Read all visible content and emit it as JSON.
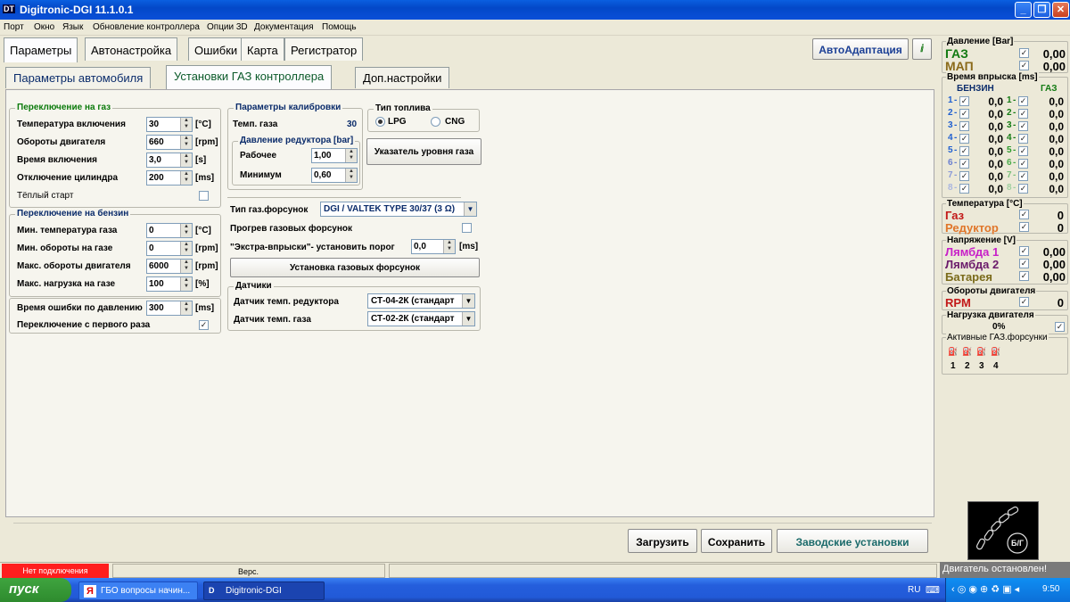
{
  "window": {
    "title": "Digitronic-DGI  11.1.0.1",
    "icon": "DT"
  },
  "menu": [
    "Порт",
    "Окно",
    "Язык",
    "Обновление контроллера",
    "Опции 3D",
    "Документация",
    "Помощь"
  ],
  "tabs": [
    "Параметры",
    "Автонастройка",
    "Ошибки",
    "Карта",
    "Регистратор"
  ],
  "auto_adapt": "АвтоАдаптация",
  "subtabs": [
    "Параметры автомобиля",
    "Установки ГАЗ контроллера",
    "Доп.настройки"
  ],
  "switch_gas": {
    "title": "Переключение на газ",
    "rows": [
      {
        "label": "Температура включения",
        "value": "30",
        "unit": "[°C]"
      },
      {
        "label": "Обороты двигателя",
        "value": "660",
        "unit": "[rpm]"
      },
      {
        "label": "Время включения",
        "value": "3,0",
        "unit": "[s]"
      },
      {
        "label": "Отключение цилиндра",
        "value": "200",
        "unit": "[ms]"
      }
    ],
    "warm_start": "Тёплый старт"
  },
  "switch_petrol": {
    "title": "Переключение на бензин",
    "rows": [
      {
        "label": "Мин. температура газа",
        "value": "0",
        "unit": "[°C]"
      },
      {
        "label": "Мин. обороты на газе",
        "value": "0",
        "unit": "[rpm]"
      },
      {
        "label": "Макс. обороты двигателя",
        "value": "6000",
        "unit": "[rpm]"
      },
      {
        "label": "Макс. нагрузка на газе",
        "value": "100",
        "unit": "[%]"
      }
    ]
  },
  "pressure_error": {
    "label": "Время ошибки по давлению",
    "value": "300",
    "unit": "[ms]"
  },
  "first_switch": {
    "label": "Переключение с первого раза"
  },
  "calibration": {
    "title": "Параметры калибровки",
    "gas_temp_label": "Темп. газа",
    "gas_temp_value": "30",
    "reducer_title": "Давление редуктора [bar]",
    "working_label": "Рабочее",
    "working_value": "1,00",
    "min_label": "Минимум",
    "min_value": "0,60"
  },
  "fuel_type": {
    "title": "Тип топлива",
    "lpg": "LPG",
    "cng": "CNG"
  },
  "level_button": "Указатель уровня газа",
  "injector_type": {
    "label": "Тип газ.форсунок",
    "value": "DGI / VALTEK TYPE 30/37 (3 Ω)"
  },
  "injector_warmup": "Прогрев газовых форсунок",
  "extra_injection": {
    "label": "\"Экстра-впрыски\"- установить порог",
    "value": "0,0",
    "unit": "[ms]"
  },
  "install_injectors_button": "Установка газовых форсунок",
  "sensors": {
    "title": "Датчики",
    "reducer_label": "Датчик темп. редуктора",
    "reducer_value": "СТ-04-2К (стандарт",
    "gas_label": "Датчик темп. газа",
    "gas_value": "СТ-02-2К (стандарт"
  },
  "bottom_buttons": {
    "load": "Загрузить",
    "save": "Сохранить",
    "factory": "Заводские установки"
  },
  "right_panel": {
    "pressure": {
      "title": "Давление [Bar]",
      "gas_label": "ГАЗ",
      "gas_value": "0,00",
      "map_label": "МАП",
      "map_value": "0,00"
    },
    "injection": {
      "title": "Время впрыска [ms]",
      "petrol_header": "БЕНЗИН",
      "gas_header": "ГАЗ",
      "cylinders": [
        "1",
        "2",
        "3",
        "4",
        "5",
        "6",
        "7",
        "8"
      ],
      "value": "0,0"
    },
    "temperature": {
      "title": "Температура  [°C]",
      "gas_label": "Газ",
      "gas_value": "0",
      "reducer_label": "Редуктор",
      "reducer_value": "0"
    },
    "voltage": {
      "title": "Напряжение [V]",
      "lambda1_label": "Лямбда 1",
      "lambda1_value": "0,00",
      "lambda2_label": "Лямбда 2",
      "lambda2_value": "0,00",
      "battery_label": "Батарея",
      "battery_value": "0,00"
    },
    "rpm": {
      "title": "Обороты двигателя",
      "label": "RPM",
      "value": "0"
    },
    "load": {
      "title": "Нагрузка двигателя",
      "value": "0%"
    },
    "active_injectors": {
      "title": "Активные ГАЗ.форсунки",
      "numbers": [
        "1",
        "2",
        "3",
        "4"
      ]
    },
    "switch_label": "Б/Г",
    "engine_status": "Двигатель остановлен!"
  },
  "statusbar": {
    "connection": "Нет подключения",
    "version": "Верс."
  },
  "taskbar": {
    "start": "пуск",
    "tasks": [
      "ГБО вопросы начин...",
      "Digitronic-DGI"
    ],
    "lang": "RU",
    "time": "9:50"
  },
  "colors": {
    "gas_green": "#127a12",
    "map_brown": "#8a6a1a",
    "lambda1": "#c81fc8",
    "lambda2": "#6a1a6a",
    "battery": "#7a6a1a",
    "red_label": "#c21818",
    "reducer_orange": "#e0762a",
    "connection_red": "#ff1e1e"
  }
}
